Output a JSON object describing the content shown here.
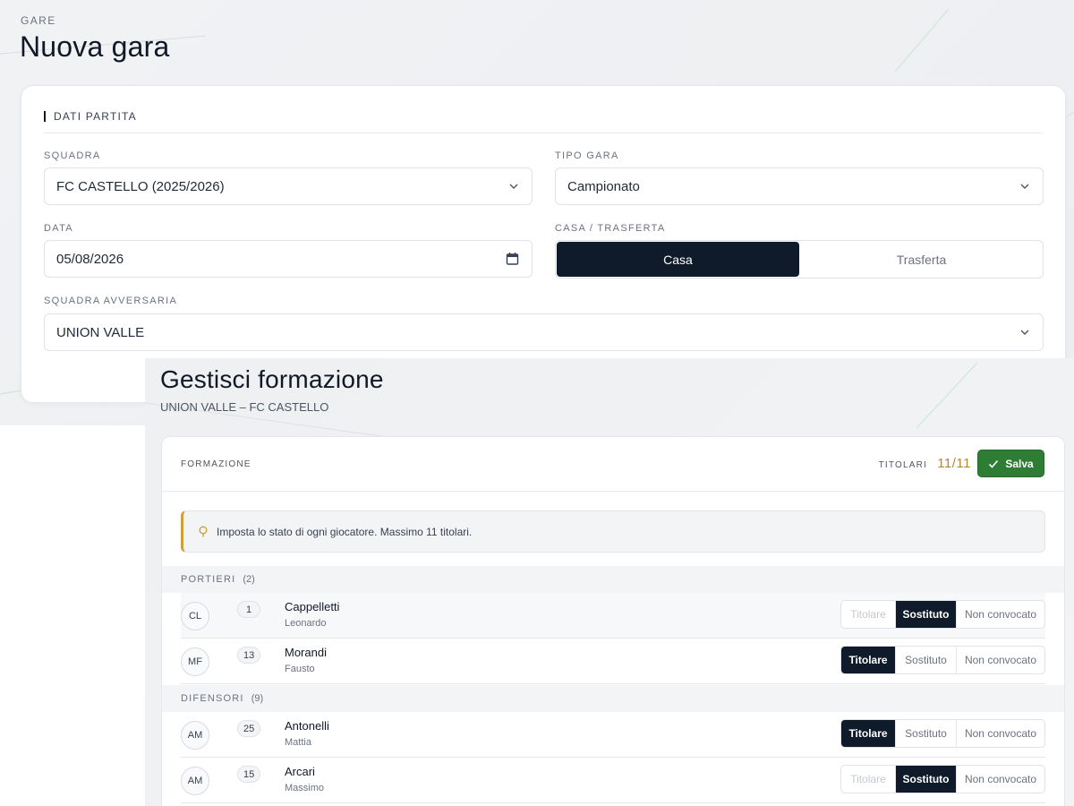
{
  "back": {
    "eyebrow": "GARE",
    "title": "Nuova gara",
    "section_title": "DATI PARTITA",
    "squadra_label": "SQUADRA",
    "squadra_value": "FC CASTELLO (2025/2026)",
    "tipo_label": "TIPO GARA",
    "tipo_value": "Campionato",
    "data_label": "DATA",
    "data_value": "05/08/2026",
    "casa_label": "CASA / TRASFERTA",
    "casa_option": "Casa",
    "trasferta_option": "Trasferta",
    "casa_selected": "Casa",
    "avversaria_label": "SQUADRA AVVERSARIA",
    "avversaria_value": "UNION VALLE"
  },
  "front": {
    "title": "Gestisci formazione",
    "subtitle": "UNION VALLE – FC CASTELLO",
    "formazione_label": "FORMAZIONE",
    "titolari_label": "TITOLARI",
    "titolari_count": "11/11",
    "save_label": "Salva",
    "alert_text": "Imposta lo stato di ogni giocatore. Massimo 11 titolari."
  },
  "groups": [
    {
      "label": "PORTIERI",
      "count": "(2)"
    },
    {
      "label": "DIFENSORI",
      "count": "(9)"
    }
  ],
  "status_labels": {
    "titolare": "Titolare",
    "sostituto": "Sostituto",
    "non_convocato": "Non convocato"
  },
  "players": [
    {
      "initials": "CL",
      "number": "1",
      "last": "Cappelletti",
      "first": "Leonardo",
      "status": "Sostituto"
    },
    {
      "initials": "MF",
      "number": "13",
      "last": "Morandi",
      "first": "Fausto",
      "status": "Titolare"
    },
    {
      "initials": "AM",
      "number": "25",
      "last": "Antonelli",
      "first": "Mattia",
      "status": "Titolare"
    },
    {
      "initials": "AM",
      "number": "15",
      "last": "Arcari",
      "first": "Massimo",
      "status": "Sostituto"
    }
  ],
  "colors": {
    "dark": "#0f1b2a",
    "save_green": "#2f7d35",
    "accent_gold": "#c9a23a"
  }
}
